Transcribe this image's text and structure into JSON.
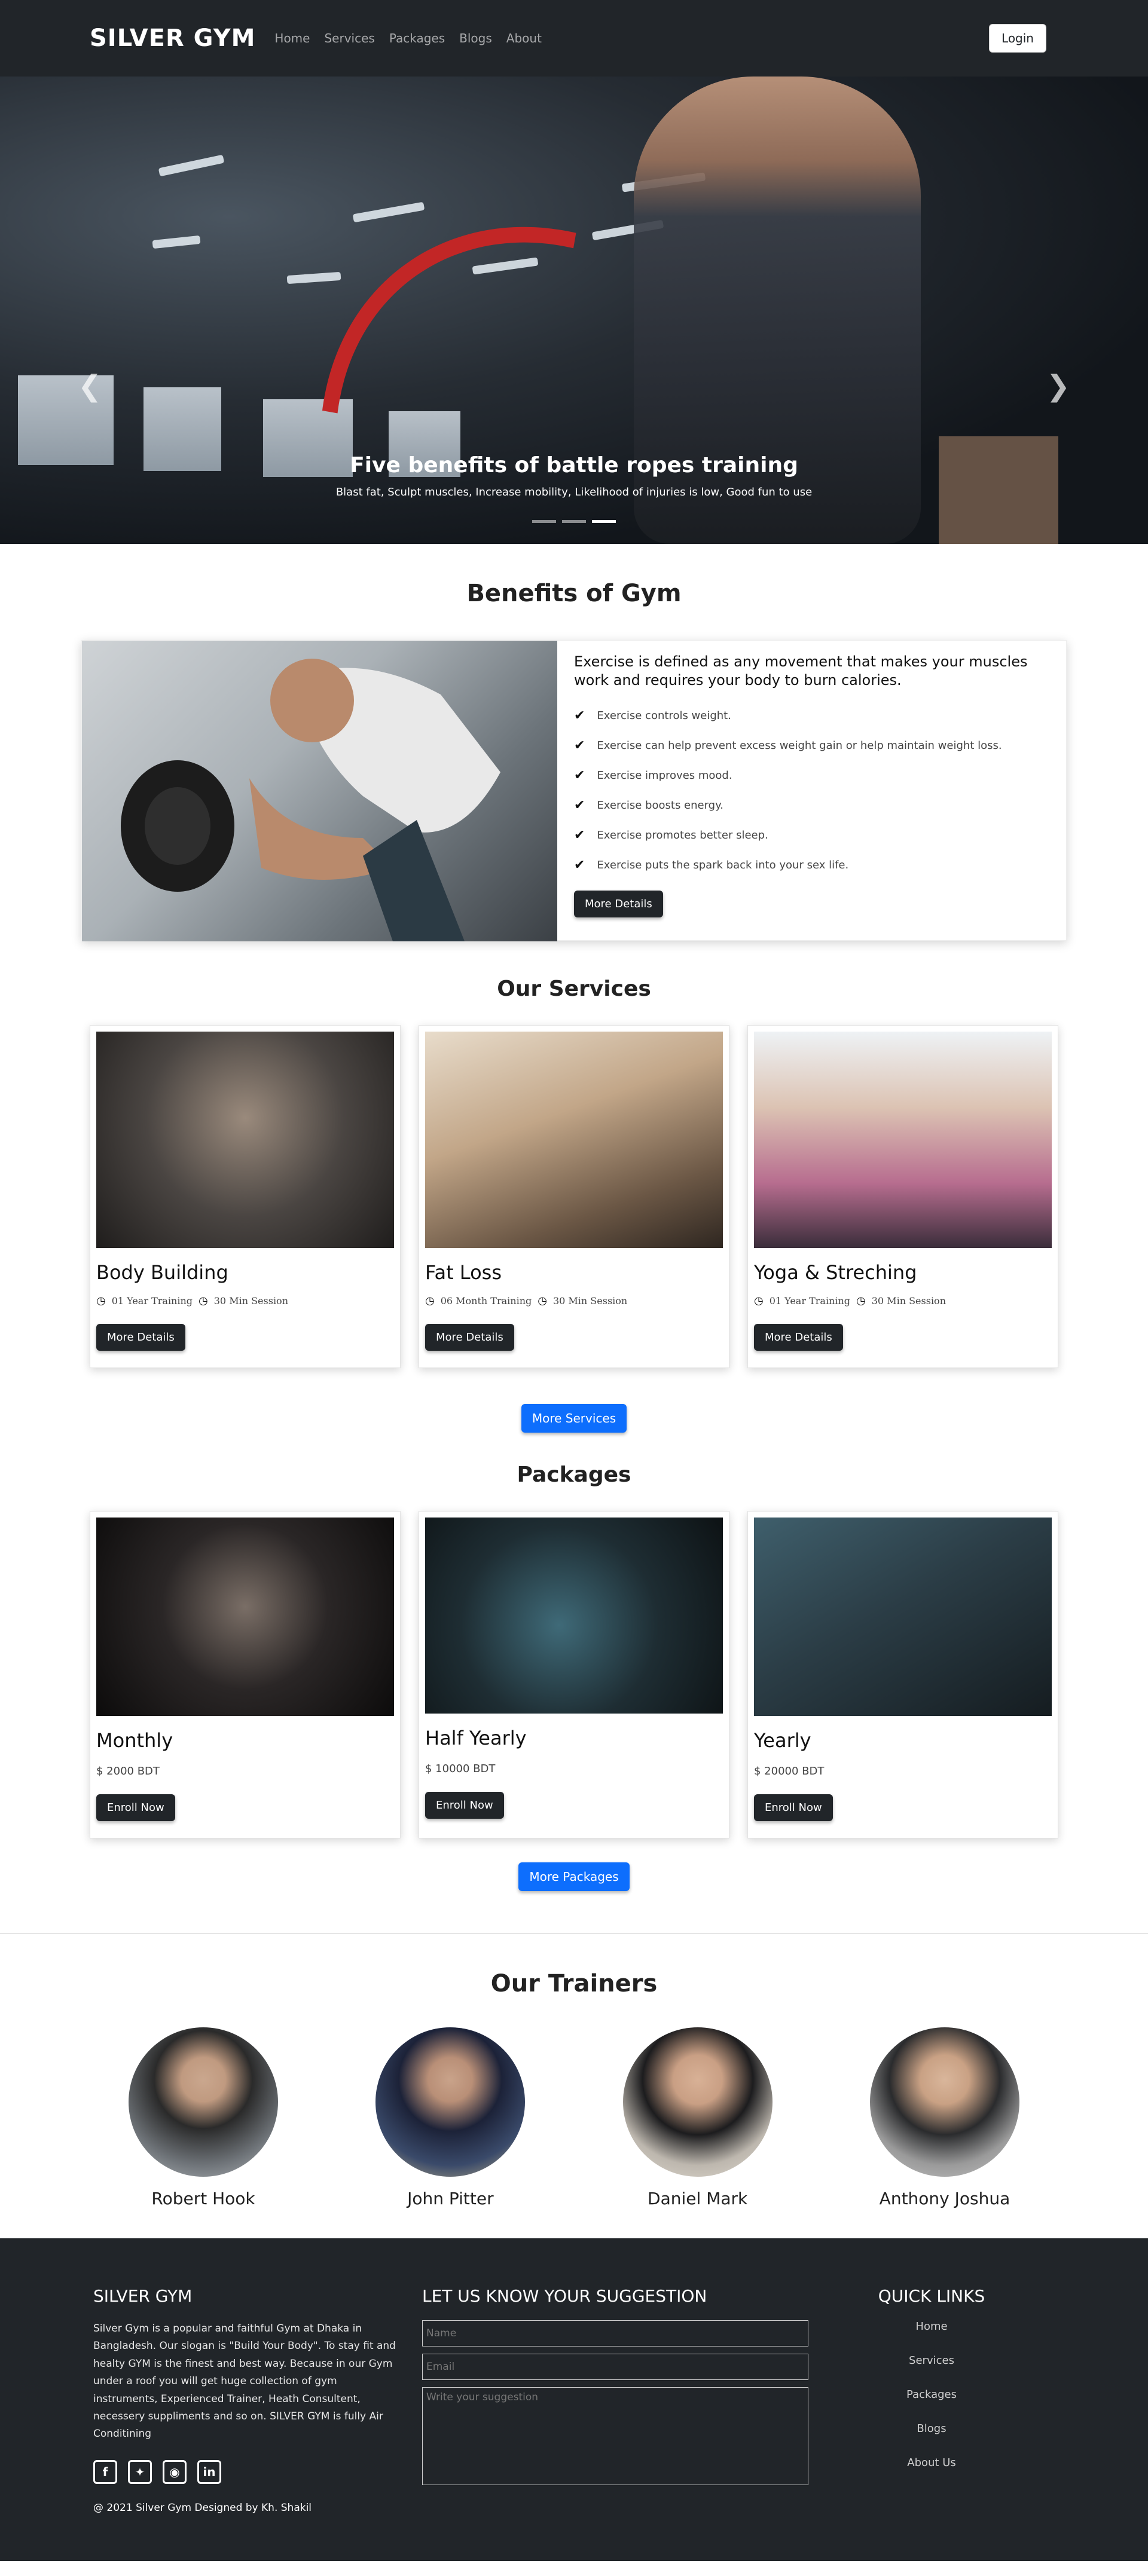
{
  "nav": {
    "brand": "SILVER GYM",
    "links": [
      "Home",
      "Services",
      "Packages",
      "Blogs",
      "About"
    ],
    "login": "Login"
  },
  "hero": {
    "title": "Five benefits of battle ropes training",
    "subtitle": "Blast fat, Sculpt muscles, Increase mobility, Likelihood of injuries is low, Good fun to use",
    "prev_icon": "chevron-left-icon",
    "next_icon": "chevron-right-icon",
    "slides": 3,
    "active_slide": 2
  },
  "benefits": {
    "title": "Benefits of Gym",
    "heading": "Exercise is defined as any movement that makes your muscles work and requires your body to burn calories.",
    "items": [
      "Exercise controls weight.",
      "Exercise can help prevent excess weight gain or help maintain weight loss.",
      "Exercise improves mood.",
      "Exercise boosts energy.",
      "Exercise promotes better sleep.",
      "Exercise puts the spark back into your sex life."
    ],
    "button": "More Details"
  },
  "services": {
    "title": "Our Services",
    "cards": [
      {
        "name": "Body Building",
        "duration": "01 Year Training",
        "session": "30 Min Session",
        "button": "More Details"
      },
      {
        "name": "Fat Loss",
        "duration": "06 Month Training",
        "session": "30 Min Session",
        "button": "More Details"
      },
      {
        "name": "Yoga & Streching",
        "duration": "01 Year Training",
        "session": "30 Min Session",
        "button": "More Details"
      }
    ],
    "more_button": "More Services"
  },
  "packages": {
    "title": "Packages",
    "cards": [
      {
        "name": "Monthly",
        "price": "$ 2000 BDT",
        "button": "Enroll Now"
      },
      {
        "name": "Half Yearly",
        "price": "$ 10000 BDT",
        "button": "Enroll Now"
      },
      {
        "name": "Yearly",
        "price": "$ 20000 BDT",
        "button": "Enroll Now"
      }
    ],
    "more_button": "More Packages"
  },
  "trainers": {
    "title": "Our Trainers",
    "names": [
      "Robert Hook",
      "John Pitter",
      "Daniel Mark",
      "Anthony Joshua"
    ]
  },
  "footer": {
    "about_title": "SILVER GYM",
    "about_text": "Silver Gym is a popular and faithful Gym at Dhaka in Bangladesh. Our slogan is \"Build Your Body\". To stay fit and healty GYM is the finest and best way. Because in our Gym under a roof you will get huge collection of gym instruments, Experienced Trainer, Heath Consultent, necessery suppliments and so on. SILVER GYM is fully Air Conditining",
    "social_icons": [
      "facebook-icon",
      "twitter-icon",
      "instagram-icon",
      "linkedin-icon"
    ],
    "copyright": "@ 2021 Silver Gym Designed by Kh. Shakil",
    "suggestion_title": "LET US KNOW YOUR SUGGESTION",
    "name_placeholder": "Name",
    "email_placeholder": "Email",
    "suggestion_placeholder": "Write your suggestion",
    "quick_title": "QUICK LINKS",
    "quick_links": [
      "Home",
      "Services",
      "Packages",
      "Blogs",
      "About Us"
    ]
  },
  "colors": {
    "dark": "#212529",
    "primary": "#0d6efd",
    "rope": "#c22626"
  }
}
